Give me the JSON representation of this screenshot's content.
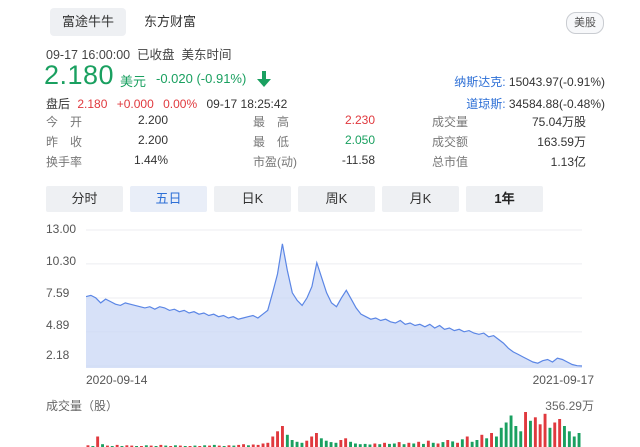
{
  "header": {
    "tabs": [
      {
        "label": "富途牛牛"
      },
      {
        "label": "东方财富"
      }
    ],
    "market_badge": "美股"
  },
  "quote": {
    "status_line": "09-17 16:00:00  已收盘  美东时间",
    "price": "2.180",
    "currency": "美元",
    "change": "-0.020 (-0.91%)",
    "after_hours": {
      "label": "盘后",
      "price": "2.180",
      "change": "+0.000",
      "percent": "0.00%",
      "time": "09-17 18:25:42"
    }
  },
  "indices": [
    {
      "name": "纳斯达克:",
      "value": "15043.97(-0.91%)"
    },
    {
      "name": "道琼斯:",
      "value": "34584.88(-0.48%)"
    }
  ],
  "stats": [
    {
      "label": "今　开",
      "value": "2.200",
      "color": "#333333"
    },
    {
      "label": "最　高",
      "value": "2.230",
      "color": "#e0393e"
    },
    {
      "label": "成交量",
      "value": "75.04万股",
      "color": "#333333"
    },
    {
      "label": "昨　收",
      "value": "2.200",
      "color": "#333333"
    },
    {
      "label": "最　低",
      "value": "2.050",
      "color": "#1aa060"
    },
    {
      "label": "成交额",
      "value": "163.59万",
      "color": "#333333"
    },
    {
      "label": "换手率",
      "value": "1.44%",
      "color": "#333333"
    },
    {
      "label": "市盈(动)",
      "value": "-11.58",
      "color": "#333333"
    },
    {
      "label": "总市值",
      "value": "1.13亿",
      "color": "#333333"
    }
  ],
  "period_tabs": [
    {
      "label": "分时"
    },
    {
      "label": "五日"
    },
    {
      "label": "日K"
    },
    {
      "label": "周K"
    },
    {
      "label": "月K"
    },
    {
      "label": "1年"
    }
  ],
  "volume_label": "成交量（股）",
  "volume_max": "356.29万",
  "colors": {
    "up": "#e0393e",
    "down": "#1aa060",
    "line": "#5b86e5",
    "fill": "#c9d7f6"
  },
  "chart_data": {
    "type": "area",
    "y_ticks": [
      "13.00",
      "10.30",
      "7.59",
      "4.89",
      "2.18"
    ],
    "ylim": [
      2.18,
      13.0
    ],
    "x_ticks": [
      "2020-09-14",
      "2021-09-17"
    ],
    "series": [
      {
        "values": [
          7.7,
          7.8,
          7.6,
          7.2,
          7.5,
          7.3,
          7.1,
          7.0,
          7.2,
          7.1,
          7.0,
          6.9,
          6.8,
          6.9,
          6.7,
          6.9,
          6.8,
          6.6,
          6.7,
          6.5,
          6.6,
          6.4,
          6.5,
          6.3,
          6.4,
          6.2,
          6.3,
          6.1,
          6.2,
          6.0,
          6.1,
          5.9,
          6.0,
          6.1,
          6.2,
          6.0,
          6.3,
          6.6,
          8.0,
          9.5,
          11.9,
          9.8,
          8.0,
          7.4,
          7.0,
          7.6,
          8.5,
          10.4,
          9.2,
          8.0,
          7.2,
          6.9,
          7.6,
          8.2,
          7.5,
          6.8,
          6.3,
          6.1,
          5.9,
          6.0,
          5.8,
          5.9,
          5.7,
          5.6,
          5.8,
          5.5,
          5.6,
          5.4,
          5.5,
          5.3,
          5.5,
          5.2,
          5.4,
          5.1,
          5.2,
          5.0,
          5.1,
          4.9,
          5.0,
          4.8,
          4.7,
          4.8,
          4.5,
          4.6,
          4.3,
          4.0,
          3.6,
          3.3,
          3.1,
          2.9,
          2.7,
          2.5,
          2.4,
          2.6,
          2.7,
          2.5,
          2.8,
          2.7,
          2.5,
          2.3,
          2.2,
          2.18
        ]
      }
    ],
    "volume": {
      "max": 3562900,
      "values": [
        0.05,
        0.02,
        0.3,
        0.08,
        0.04,
        0.03,
        0.06,
        0.02,
        0.05,
        0.04,
        0.03,
        0.02,
        0.05,
        0.04,
        0.03,
        0.06,
        0.04,
        0.03,
        0.05,
        0.04,
        0.03,
        0.02,
        0.04,
        0.03,
        0.05,
        0.04,
        0.06,
        0.04,
        0.03,
        0.05,
        0.04,
        0.06,
        0.08,
        0.05,
        0.07,
        0.06,
        0.1,
        0.12,
        0.3,
        0.45,
        0.6,
        0.35,
        0.2,
        0.15,
        0.12,
        0.18,
        0.3,
        0.4,
        0.25,
        0.18,
        0.14,
        0.12,
        0.2,
        0.25,
        0.15,
        0.1,
        0.08,
        0.09,
        0.07,
        0.1,
        0.08,
        0.12,
        0.09,
        0.1,
        0.14,
        0.08,
        0.12,
        0.1,
        0.15,
        0.09,
        0.18,
        0.12,
        0.1,
        0.14,
        0.2,
        0.16,
        0.12,
        0.22,
        0.3,
        0.15,
        0.2,
        0.35,
        0.25,
        0.4,
        0.3,
        0.55,
        0.7,
        0.9,
        0.6,
        0.45,
        1.0,
        0.75,
        0.85,
        0.65,
        0.95,
        0.55,
        0.7,
        0.8,
        0.6,
        0.45,
        0.3,
        0.4
      ],
      "up": [
        true,
        false,
        true,
        false,
        true,
        false,
        true,
        false,
        true,
        true,
        false,
        true,
        false,
        true,
        false,
        true,
        false,
        true,
        false,
        true,
        false,
        true,
        false,
        true,
        false,
        true,
        false,
        true,
        false,
        true,
        false,
        true,
        true,
        false,
        true,
        true,
        true,
        true,
        true,
        true,
        true,
        false,
        false,
        false,
        false,
        true,
        true,
        true,
        false,
        false,
        false,
        false,
        true,
        true,
        false,
        false,
        false,
        false,
        false,
        true,
        false,
        true,
        false,
        false,
        true,
        false,
        true,
        false,
        true,
        false,
        true,
        false,
        true,
        false,
        true,
        false,
        true,
        false,
        true,
        false,
        false,
        true,
        false,
        true,
        false,
        false,
        false,
        false,
        false,
        false,
        true,
        false,
        true,
        true,
        true,
        false,
        true,
        true,
        false,
        false,
        false,
        false
      ]
    }
  }
}
